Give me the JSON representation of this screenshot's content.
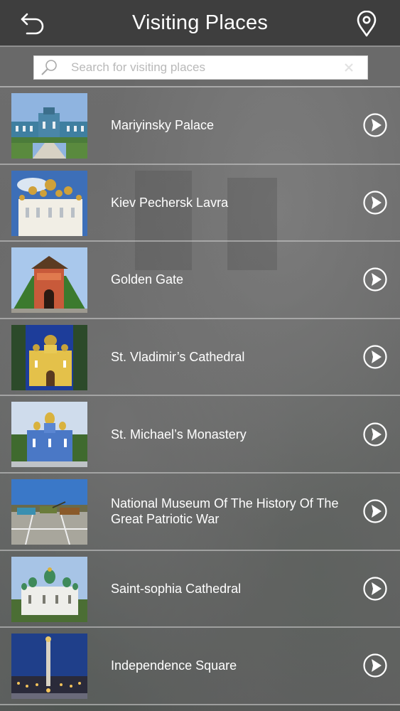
{
  "header": {
    "title": "Visiting Places",
    "back_icon": "back-arrow-icon",
    "map_icon": "location-pin-icon"
  },
  "search": {
    "placeholder": "Search for visiting places",
    "value": ""
  },
  "places": [
    {
      "name": "Mariyinsky Palace",
      "thumb": "palace"
    },
    {
      "name": "Kiev Pechersk Lavra",
      "thumb": "lavra"
    },
    {
      "name": "Golden Gate",
      "thumb": "gate"
    },
    {
      "name": "St. Vladimir’s Cathedral",
      "thumb": "vladimir"
    },
    {
      "name": "St. Michael’s Monastery",
      "thumb": "michael"
    },
    {
      "name": "National Museum Of The History Of The Great Patriotic War",
      "thumb": "museum"
    },
    {
      "name": "Saint-sophia Cathedral",
      "thumb": "sophia"
    },
    {
      "name": "Independence Square",
      "thumb": "square"
    }
  ],
  "colors": {
    "header_bg": "#3e3e3e",
    "row_divider": "#d2d2d2",
    "text": "#ffffff"
  }
}
